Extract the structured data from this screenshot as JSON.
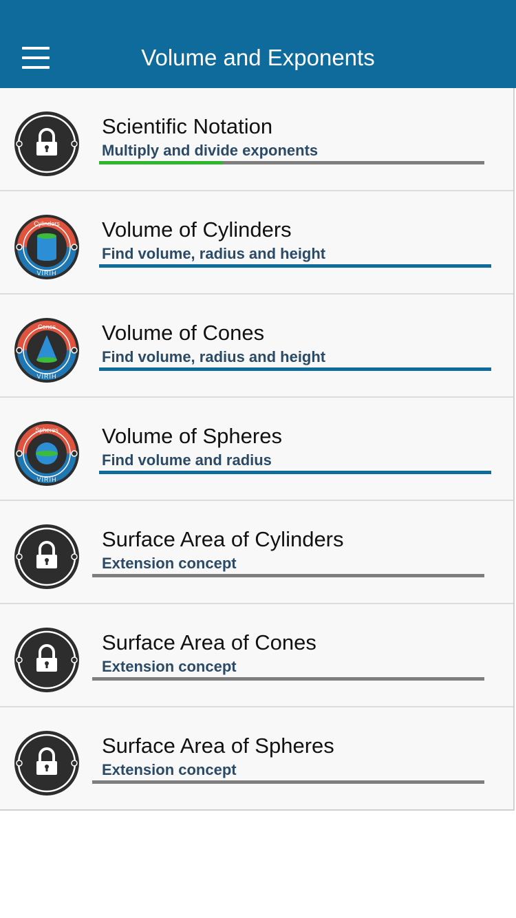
{
  "header": {
    "title": "Volume and Exponents",
    "menu_icon": "hamburger-menu-icon"
  },
  "colors": {
    "header_bg": "#0f6b9b",
    "progress_done": "#0f6b9b",
    "progress_partial": "#2fb52e",
    "progress_track": "#7f7f7f",
    "badge_red": "#e0533e",
    "badge_blue": "#1f78b4",
    "shape_blue": "#2c8fd6",
    "shape_green": "#3dbb3a"
  },
  "lessons": [
    {
      "title": "Scientific Notation",
      "subtitle": "Multiply and divide exponents",
      "status": "locked",
      "icon": "lock-icon",
      "progress": 0.32
    },
    {
      "title": "Volume of Cylinders",
      "subtitle": "Find volume, radius and height",
      "status": "unlocked",
      "icon": "cylinder-badge-icon",
      "badge_label": "Cylinders",
      "badge_footer": "VIRIH",
      "progress": 1.0
    },
    {
      "title": "Volume of Cones",
      "subtitle": "Find volume, radius and height",
      "status": "unlocked",
      "icon": "cone-badge-icon",
      "badge_label": "Cones",
      "badge_footer": "VIRIH",
      "progress": 1.0
    },
    {
      "title": "Volume of Spheres",
      "subtitle": "Find volume and radius",
      "status": "unlocked",
      "icon": "sphere-badge-icon",
      "badge_label": "Spheres",
      "badge_footer": "VIRIH",
      "progress": 1.0
    },
    {
      "title": "Surface Area of Cylinders",
      "subtitle": "Extension concept",
      "status": "locked",
      "icon": "lock-icon",
      "progress": 0
    },
    {
      "title": "Surface Area of Cones",
      "subtitle": "Extension concept",
      "status": "locked",
      "icon": "lock-icon",
      "progress": 0
    },
    {
      "title": "Surface Area of Spheres",
      "subtitle": "Extension concept",
      "status": "locked",
      "icon": "lock-icon",
      "progress": 0
    }
  ]
}
